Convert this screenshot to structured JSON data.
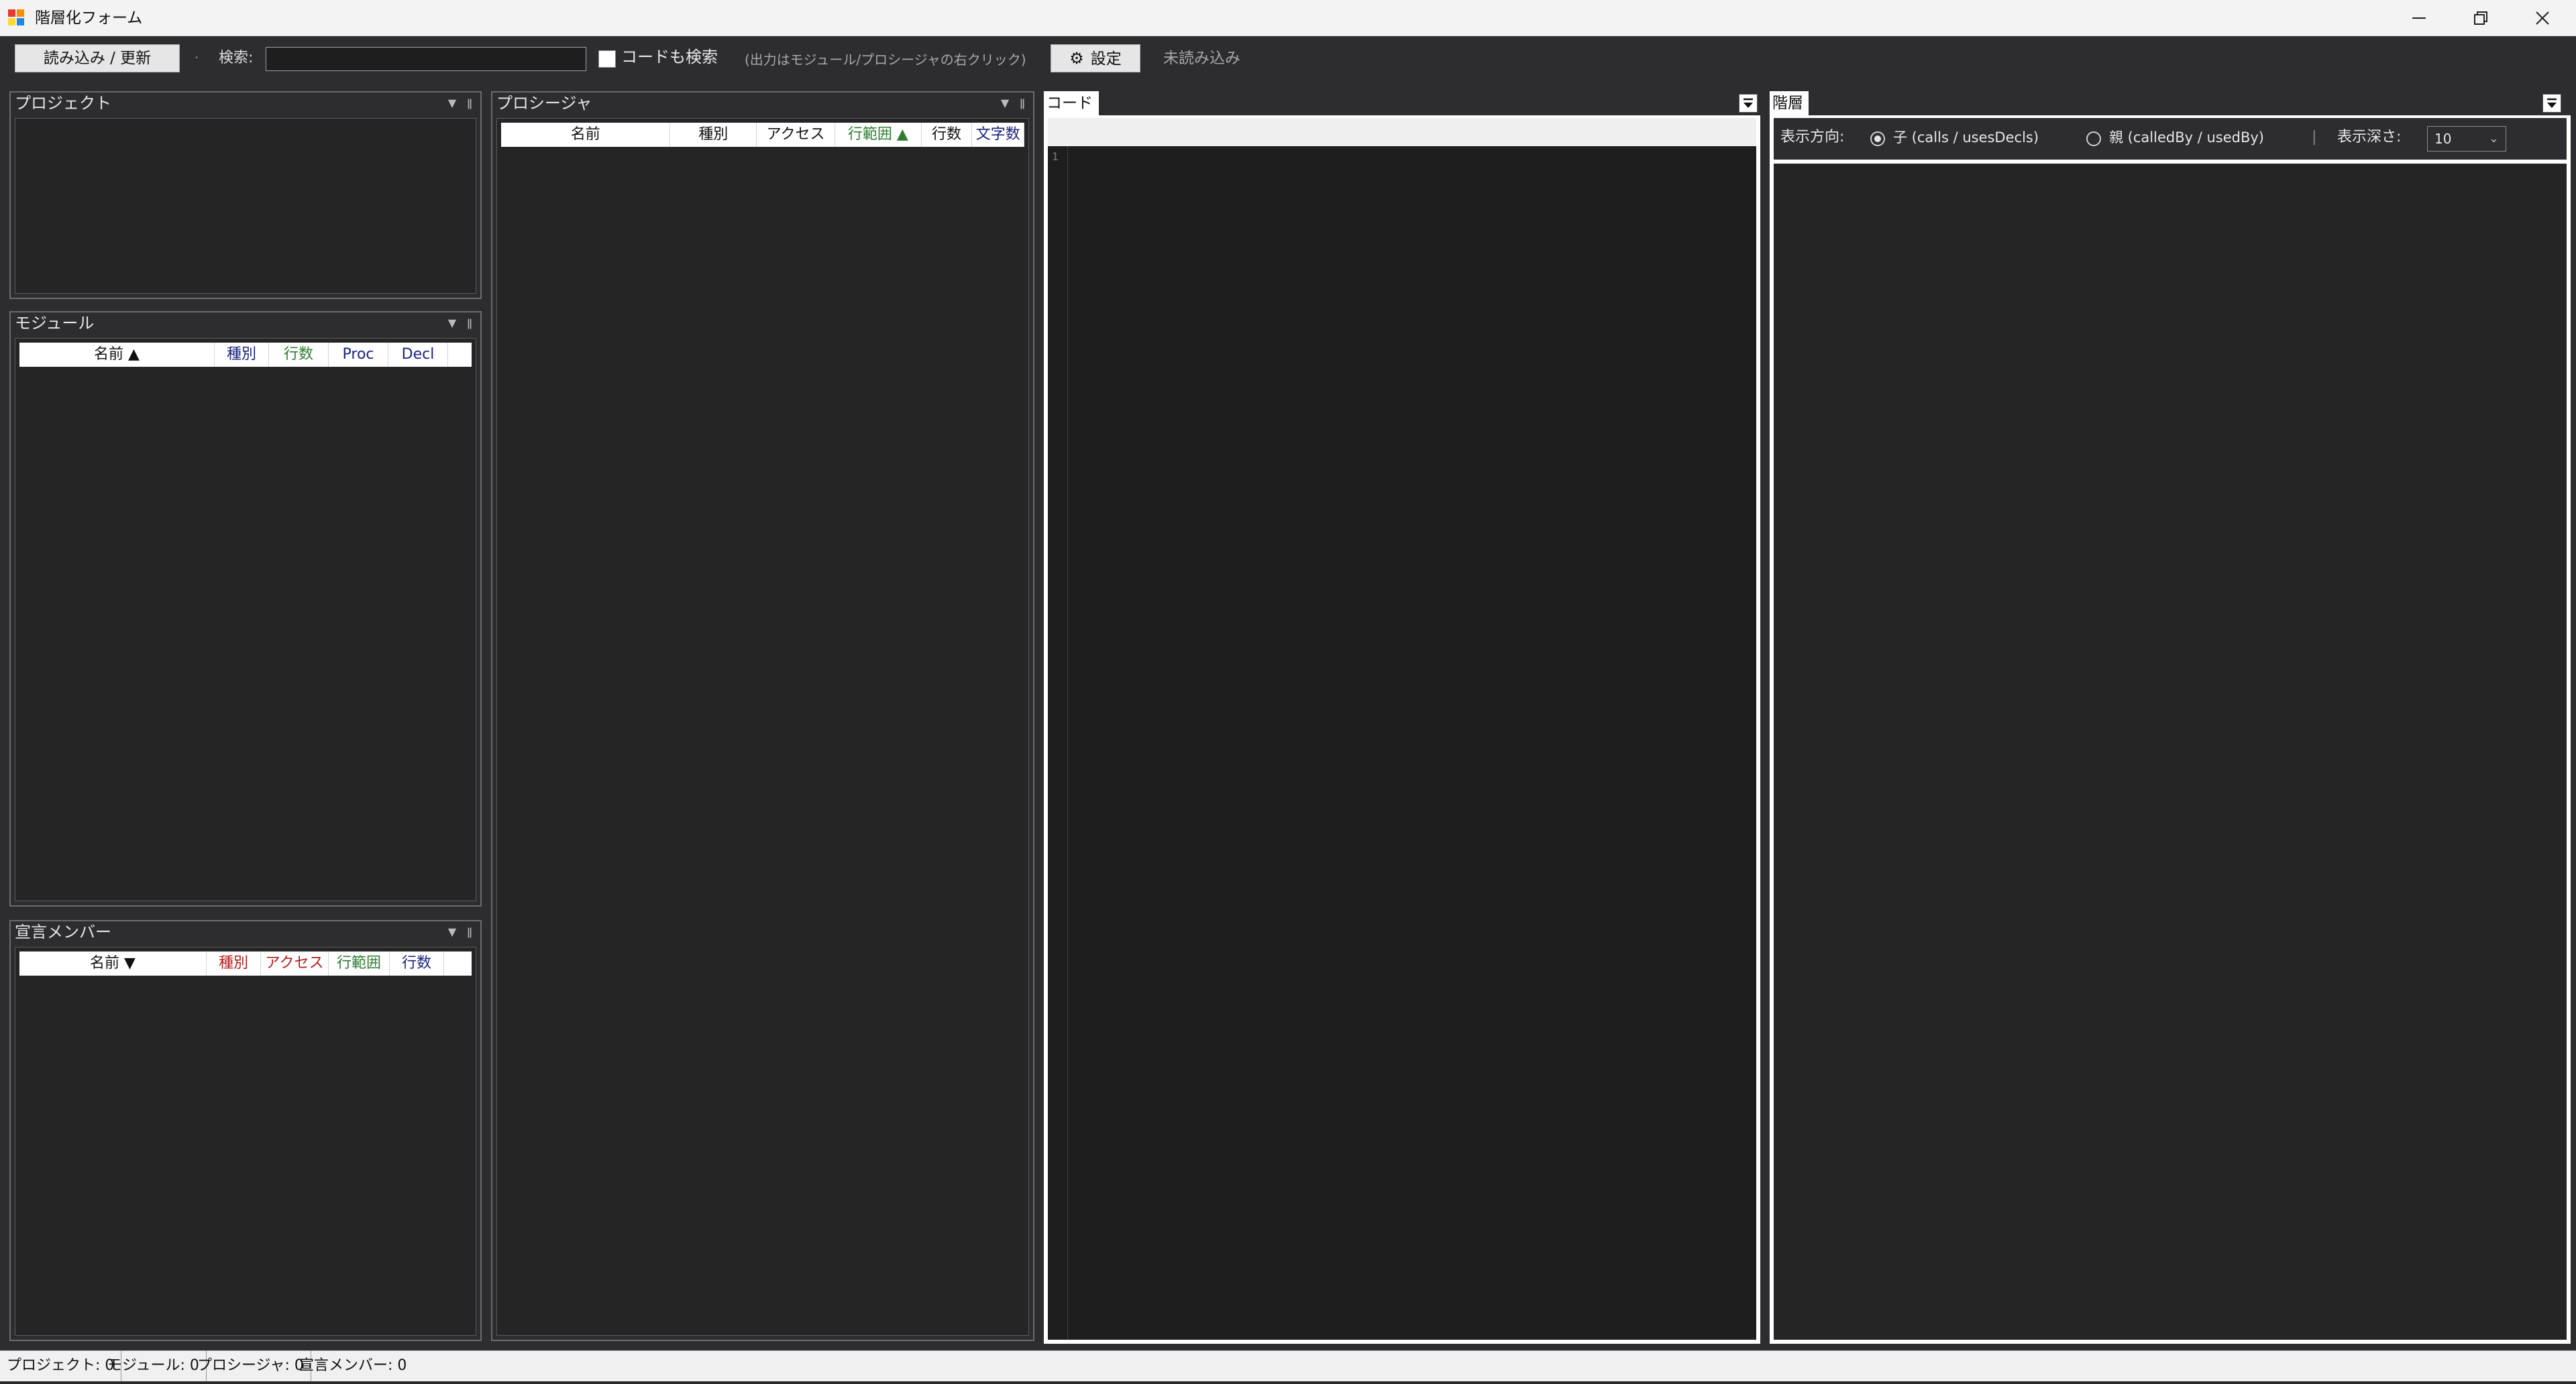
{
  "window": {
    "title": "階層化フォーム"
  },
  "toolbar": {
    "load_label": "読み込み / 更新",
    "separator": "·",
    "search_label": "検索:",
    "search_value": "",
    "code_search_label": "コードも検索",
    "hint": "(出力はモジュール/プロシージャの右クリック)",
    "settings_label": "設定",
    "status": "未読み込み"
  },
  "panels": {
    "project": {
      "title": "プロジェクト"
    },
    "module": {
      "title": "モジュール",
      "columns": [
        "名前 ▲",
        "種別",
        "行数",
        "Proc",
        "Decl"
      ]
    },
    "decl": {
      "title": "宣言メンバー",
      "columns": [
        "名前 ▼",
        "種別",
        "アクセス",
        "行範囲",
        "行数"
      ]
    },
    "procedure": {
      "title": "プロシージャ",
      "columns": [
        "名前",
        "種別",
        "アクセス",
        "行範囲 ▲",
        "行数",
        "文字数"
      ]
    },
    "code": {
      "tab": "コード",
      "line_number": "1"
    },
    "hierarchy": {
      "tab": "階層",
      "direction_label": "表示方向:",
      "child_label": "子 (calls / usesDecls)",
      "parent_label": "親 (calledBy / usedBy)",
      "divider": "|",
      "depth_label": "表示深さ:",
      "depth_value": "10"
    }
  },
  "statusbar": {
    "projects": "プロジェクト: 0",
    "modules": "モジュール: 0",
    "procedures": "プロシージャ: 0",
    "decls": "宣言メンバー: 0"
  },
  "colors": {
    "background": "#2d2d30",
    "panel_body": "#252526",
    "editor": "#1e1e1e",
    "column_green": "#2e7d32",
    "column_red": "#b71c1c",
    "column_blue": "#1a237e"
  }
}
